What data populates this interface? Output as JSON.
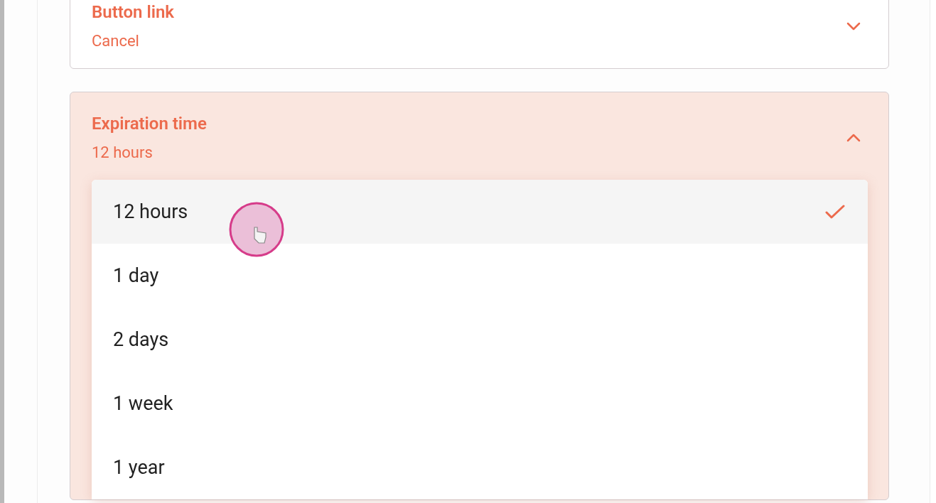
{
  "settings": [
    {
      "label": "Button link",
      "value": "Cancel",
      "expanded": false
    },
    {
      "label": "Expiration time",
      "value": "12 hours",
      "expanded": true,
      "options": [
        {
          "label": "12 hours",
          "selected": true
        },
        {
          "label": "1 day",
          "selected": false
        },
        {
          "label": "2 days",
          "selected": false
        },
        {
          "label": "1 week",
          "selected": false
        },
        {
          "label": "1 year",
          "selected": false
        }
      ]
    }
  ]
}
